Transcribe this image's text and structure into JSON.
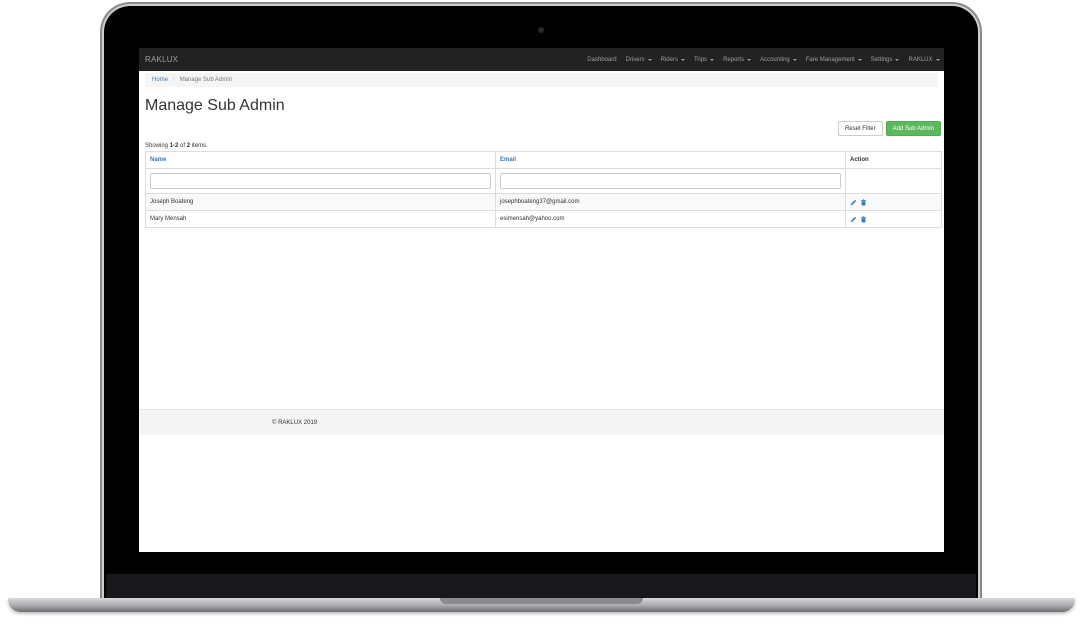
{
  "navbar": {
    "brand": "RAKLUX",
    "items": [
      {
        "label": "Dashboard",
        "dropdown": false
      },
      {
        "label": "Drivers",
        "dropdown": true
      },
      {
        "label": "Riders",
        "dropdown": true
      },
      {
        "label": "Trips",
        "dropdown": true
      },
      {
        "label": "Reports",
        "dropdown": true
      },
      {
        "label": "Accounting",
        "dropdown": true
      },
      {
        "label": "Fare Management",
        "dropdown": true
      },
      {
        "label": "Settings",
        "dropdown": true
      },
      {
        "label": "RAKLUX",
        "dropdown": true
      }
    ]
  },
  "breadcrumb": {
    "home": "Home",
    "separator": "/",
    "current": "Manage Sub Admin"
  },
  "page": {
    "title": "Manage Sub Admin",
    "reset_label": "Reset Filter",
    "add_label": "Add Sub Admin",
    "summary_prefix": "Showing ",
    "summary_range": "1-2",
    "summary_mid": " of ",
    "summary_total": "2",
    "summary_suffix": " items."
  },
  "table": {
    "headers": {
      "name": "Name",
      "email": "Email",
      "action": "Action"
    },
    "rows": [
      {
        "name": "Joseph Boateng",
        "email": "josephboateng37@gmail.com"
      },
      {
        "name": "Mary Mensah",
        "email": "esimensah@yahoo.com"
      }
    ],
    "action_icons": [
      "pencil-icon",
      "trash-icon"
    ]
  },
  "footer": {
    "text": "© RAKLUX 2019"
  },
  "colors": {
    "navbar": "#222222",
    "link": "#337ab7",
    "success": "#5cb85c"
  }
}
